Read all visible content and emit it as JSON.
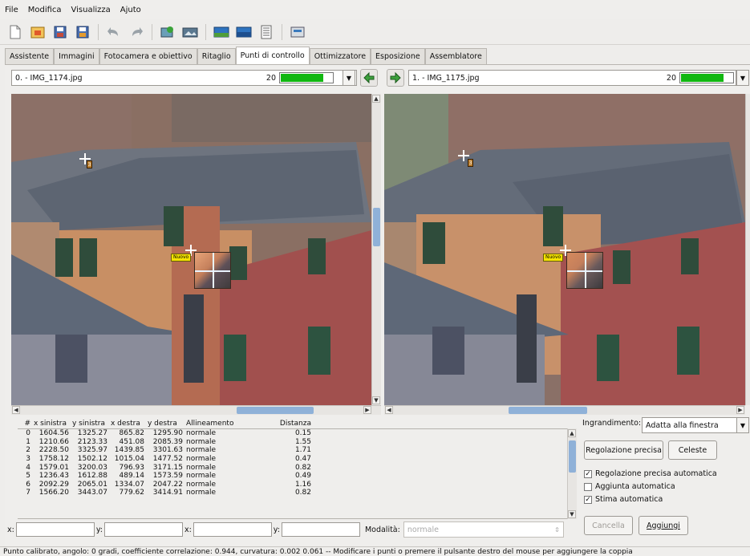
{
  "menu": [
    "File",
    "Modifica",
    "Visualizza",
    "Ajuto"
  ],
  "toolbar": [
    "new-icon",
    "open-icon",
    "save-icon",
    "save-as-icon",
    "undo-icon",
    "redo-icon",
    "add-image-icon",
    "add-series-icon",
    "preview-icon",
    "fast-preview-icon",
    "layout-icon",
    "crop-icon"
  ],
  "tabs": [
    "Assistente",
    "Immagini",
    "Fotocamera e obiettivo",
    "Ritaglio",
    "Punti di controllo",
    "Ottimizzatore",
    "Esposizione",
    "Assemblatore"
  ],
  "active_tab": 4,
  "left": {
    "image_label": "0. - IMG_1174.jpg",
    "count": "20",
    "progress": 0.82,
    "tag": "Nuovo",
    "num": "3"
  },
  "right": {
    "image_label": "1. - IMG_1175.jpg",
    "count": "20",
    "progress": 0.82,
    "tag": "Nuovo",
    "num": "3"
  },
  "table": {
    "headers": [
      "#",
      "x sinistra",
      "y sinistra",
      "x destra",
      "y destra",
      "Allineamento",
      "Distanza"
    ],
    "rows": [
      [
        "0",
        "1604.56",
        "1325.27",
        "865.82",
        "1295.90",
        "normale",
        "0.15"
      ],
      [
        "1",
        "1210.66",
        "2123.33",
        "451.08",
        "2085.39",
        "normale",
        "1.55"
      ],
      [
        "2",
        "2228.50",
        "3325.97",
        "1439.85",
        "3301.63",
        "normale",
        "1.71"
      ],
      [
        "3",
        "1758.12",
        "1502.12",
        "1015.04",
        "1477.52",
        "normale",
        "0.47"
      ],
      [
        "4",
        "1579.01",
        "3200.03",
        "796.93",
        "3171.15",
        "normale",
        "0.82"
      ],
      [
        "5",
        "1236.43",
        "1612.88",
        "489.14",
        "1573.59",
        "normale",
        "0.49"
      ],
      [
        "6",
        "2092.29",
        "2065.01",
        "1334.07",
        "2047.22",
        "normale",
        "1.16"
      ],
      [
        "7",
        "1566.20",
        "3443.07",
        "779.62",
        "3414.91",
        "normale",
        "0.82"
      ]
    ]
  },
  "coords": {
    "x_left": "x:",
    "y_left": "y:",
    "x_right": "x:",
    "y_right": "y:",
    "mode_label": "Modalità:",
    "mode_value": "normale"
  },
  "zoom": {
    "label": "Ingrandimento:",
    "value": "Adatta alla finestra"
  },
  "buttons": {
    "fine_tune": "Regolazione precisa",
    "celeste": "Celeste",
    "cancel": "Cancella",
    "add": "Aggiungi"
  },
  "checks": [
    {
      "label": "Regolazione precisa automatica",
      "checked": true
    },
    {
      "label": "Aggiunta automatica",
      "checked": false
    },
    {
      "label": "Stima automatica",
      "checked": true
    }
  ],
  "status": "Punto calibrato, angolo: 0 gradi, coefficiente correlazione: 0.944, curvatura: 0.002 0.061  -- Modificare i punti o premere il pulsante destro del mouse per aggiungere la coppia",
  "colors": {
    "progress": "#11b711",
    "tag": "#f5e300",
    "scroll_thumb": "#8fb1d8"
  }
}
